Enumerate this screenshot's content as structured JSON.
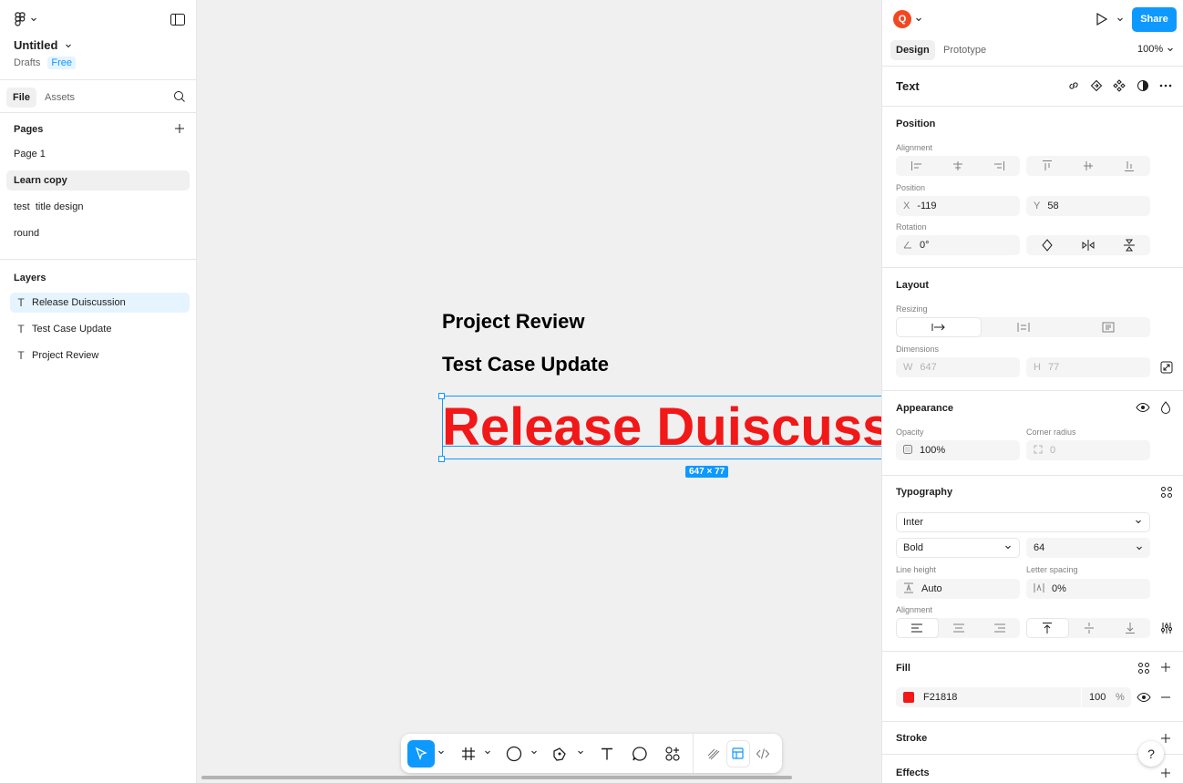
{
  "file": {
    "title": "Untitled",
    "location": "Drafts",
    "plan_badge": "Free"
  },
  "left_tabs": {
    "file": "File",
    "assets": "Assets"
  },
  "pages": {
    "heading": "Pages",
    "items": [
      {
        "label": "Page 1",
        "active": false
      },
      {
        "label": "Learn copy",
        "active": true
      },
      {
        "label": "test  title design",
        "active": false
      },
      {
        "label": "round",
        "active": false
      }
    ]
  },
  "layers": {
    "heading": "Layers",
    "items": [
      {
        "label": "Release Duiscussion",
        "active": true
      },
      {
        "label": "Test Case Update",
        "active": false
      },
      {
        "label": "Project Review",
        "active": false
      }
    ]
  },
  "canvas": {
    "project_review": "Project Review",
    "test_case_update": "Test Case Update",
    "release_discussion": "Release Duiscussion",
    "selection_size": "647 × 77"
  },
  "toolbar": {
    "tools": [
      "move-tool",
      "frame-tool",
      "shape-tool",
      "pen-tool",
      "text-tool",
      "comment-tool",
      "actions-tool",
      "draw-mode",
      "design-mode",
      "dev-mode"
    ]
  },
  "header": {
    "avatar_initial": "Q",
    "share_label": "Share",
    "tab_design": "Design",
    "tab_prototype": "Prototype",
    "zoom": "100%"
  },
  "selection": {
    "type_label": "Text"
  },
  "position": {
    "heading": "Position",
    "alignment_label": "Alignment",
    "position_label": "Position",
    "x_label": "X",
    "x": "-119",
    "y_label": "Y",
    "y": "58",
    "rotation_label": "Rotation",
    "rotation": "0°"
  },
  "layout": {
    "heading": "Layout",
    "resizing_label": "Resizing",
    "dimensions_label": "Dimensions",
    "w_label": "W",
    "w": "647",
    "h_label": "H",
    "h": "77"
  },
  "appearance": {
    "heading": "Appearance",
    "opacity_label": "Opacity",
    "opacity": "100%",
    "radius_label": "Corner radius",
    "radius": "0"
  },
  "typography": {
    "heading": "Typography",
    "font": "Inter",
    "weight": "Bold",
    "size": "64",
    "line_height_label": "Line height",
    "line_height": "Auto",
    "letter_spacing_label": "Letter spacing",
    "letter_spacing": "0%",
    "alignment_label": "Alignment"
  },
  "fill": {
    "heading": "Fill",
    "hex": "F21818",
    "opacity": "100",
    "unit": "%",
    "color": "#F21818"
  },
  "stroke": {
    "heading": "Stroke"
  },
  "effects": {
    "heading": "Effects"
  },
  "help": "?"
}
